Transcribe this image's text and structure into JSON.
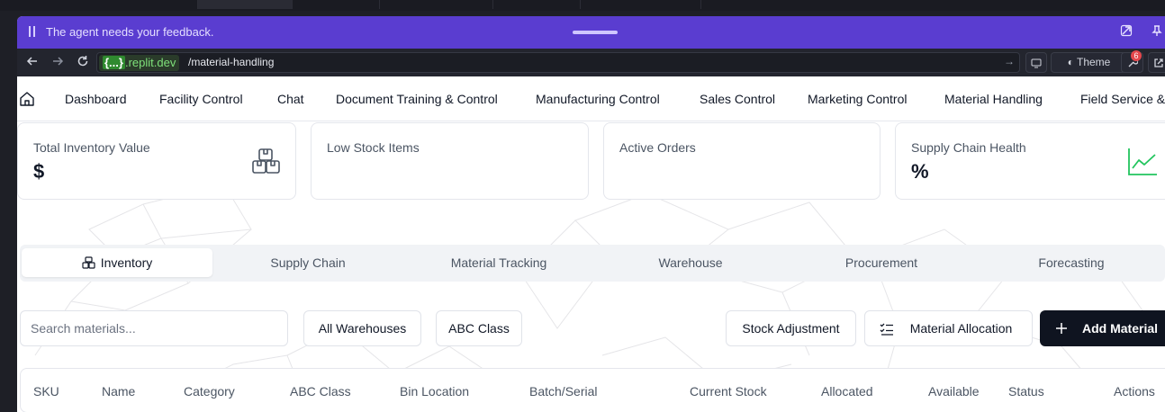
{
  "banner": {
    "message": "The agent needs your feedback."
  },
  "url_bar": {
    "domain": ".replit.dev",
    "domain_tag": "{...}",
    "path": "/material-handling",
    "notification_count": "6",
    "theme_label": "Theme"
  },
  "nav": {
    "items": [
      "Dashboard",
      "Facility Control",
      "Chat",
      "Document Training & Control",
      "Manufacturing Control",
      "Sales Control",
      "Marketing Control",
      "Material Handling",
      "Field Service &"
    ]
  },
  "cards": [
    {
      "label": "Total Inventory Value",
      "value": "$",
      "icon": "boxes-icon"
    },
    {
      "label": "Low Stock Items",
      "value": ""
    },
    {
      "label": "Active Orders",
      "value": ""
    },
    {
      "label": "Supply Chain Health",
      "value": "%",
      "icon": "trending-up-icon"
    }
  ],
  "tabs": [
    "Inventory",
    "Supply Chain",
    "Material Tracking",
    "Warehouse",
    "Procurement",
    "Forecasting"
  ],
  "toolbar": {
    "search_placeholder": "Search materials...",
    "warehouse_filter": "All Warehouses",
    "abc_filter": "ABC Class",
    "stock_adjustment": "Stock Adjustment",
    "material_allocation": "Material Allocation",
    "add_material": "Add Material"
  },
  "table": {
    "columns": [
      "SKU",
      "Name",
      "Category",
      "ABC Class",
      "Bin Location",
      "Batch/Serial",
      "Current Stock",
      "Allocated",
      "Available",
      "Status",
      "Actions"
    ]
  },
  "colors": {
    "banner": "#5a3dd0",
    "primary_button": "#0f1420",
    "health_icon": "#22c55e"
  }
}
